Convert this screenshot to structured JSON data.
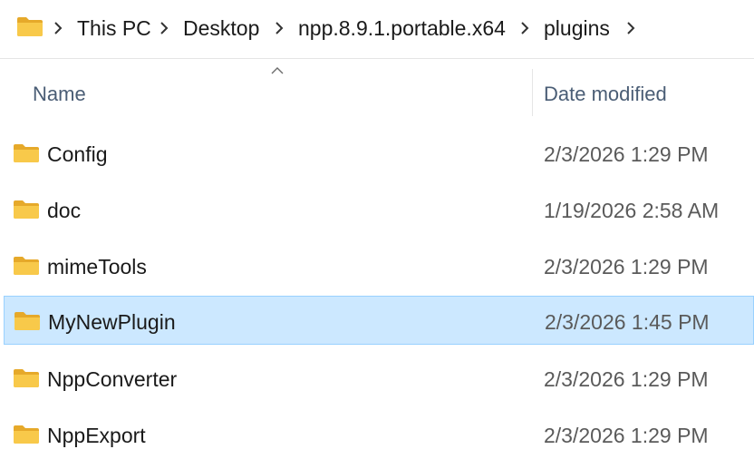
{
  "address_bar": {
    "crumbs": [
      "This PC",
      "Desktop",
      "npp.8.9.1.portable.x64",
      "plugins"
    ]
  },
  "columns": {
    "name": "Name",
    "date_modified": "Date modified",
    "sort": "ascending"
  },
  "files": [
    {
      "name": "Config",
      "date": "2/3/2026 1:29 PM",
      "type": "folder",
      "selected": false
    },
    {
      "name": "doc",
      "date": "1/19/2026 2:58 AM",
      "type": "folder",
      "selected": false
    },
    {
      "name": "mimeTools",
      "date": "2/3/2026 1:29 PM",
      "type": "folder",
      "selected": false
    },
    {
      "name": "MyNewPlugin",
      "date": "2/3/2026 1:45 PM",
      "type": "folder",
      "selected": true
    },
    {
      "name": "NppConverter",
      "date": "2/3/2026 1:29 PM",
      "type": "folder",
      "selected": false
    },
    {
      "name": "NppExport",
      "date": "2/3/2026 1:29 PM",
      "type": "folder",
      "selected": false
    }
  ],
  "colors": {
    "selection_bg": "#cce8ff",
    "selection_border": "#99d1ff",
    "folder": "#f8c94a",
    "header_text": "#4a5d75"
  },
  "icons": {
    "folder": "folder-icon",
    "chevron": "chevron-right-icon",
    "sort": "sort-ascending-icon"
  }
}
